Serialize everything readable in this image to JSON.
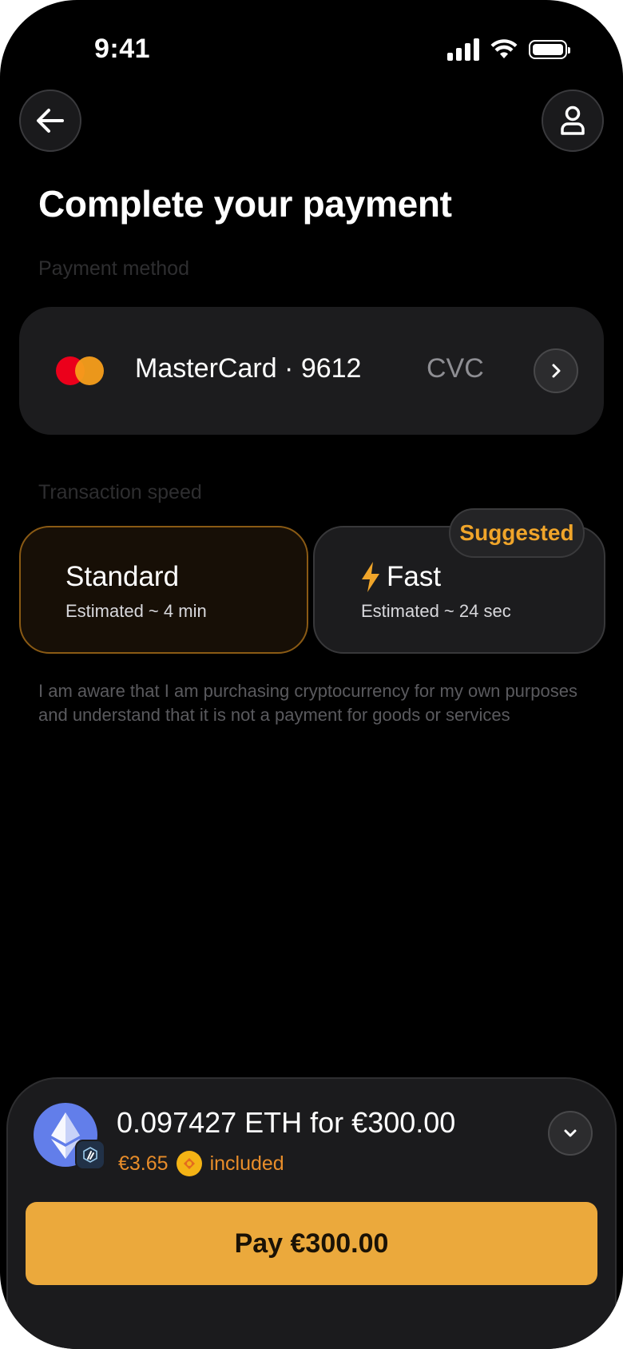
{
  "status_bar": {
    "time": "9:41"
  },
  "header": {
    "title": "Complete your payment"
  },
  "payment_method": {
    "label": "Payment method",
    "card_name": "MasterCard · 9612",
    "cvc_placeholder": "CVC"
  },
  "transaction_speed": {
    "label": "Transaction speed",
    "options": [
      {
        "title": "Standard",
        "subtitle": "Estimated ~ 4 min",
        "selected": true
      },
      {
        "title": "Fast",
        "subtitle": "Estimated ~ 24 sec",
        "badge": "Suggested",
        "selected": false
      }
    ]
  },
  "disclaimer": "I am aware that I am purchasing cryptocurrency for my own purposes and understand that it is not a payment for goods or services",
  "summary": {
    "amount": "0.097427 ETH for €300.00",
    "fee": "€3.65",
    "fee_suffix": "included"
  },
  "pay_button": {
    "label": "Pay €300.00"
  },
  "colors": {
    "accent": "#eba93c",
    "badge_text": "#f0a52a",
    "fee_text": "#e88d2a",
    "eth_blue": "#627eea"
  }
}
